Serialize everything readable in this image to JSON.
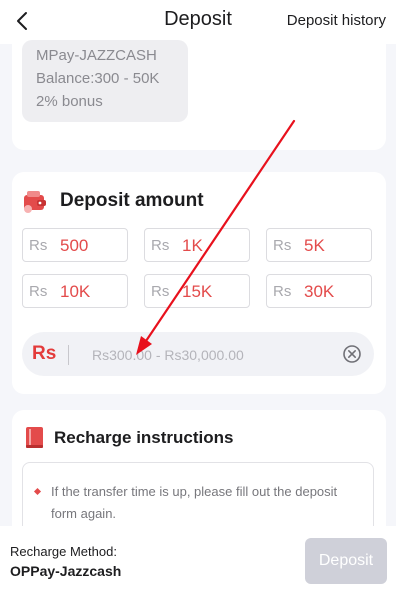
{
  "header": {
    "title": "Deposit",
    "history_label": "Deposit history",
    "back_icon": "chevron-left-icon"
  },
  "method_card": {
    "lines": [
      "MPay-JAZZCASH",
      "Balance:300 - 50K",
      "2% bonus"
    ]
  },
  "amount_card": {
    "title": "Deposit amount",
    "icon": "wallet-icon",
    "options": [
      {
        "currency": "Rs",
        "value": "500"
      },
      {
        "currency": "Rs",
        "value": "1K"
      },
      {
        "currency": "Rs",
        "value": "5K"
      },
      {
        "currency": "Rs",
        "value": "10K"
      },
      {
        "currency": "Rs",
        "value": "15K"
      },
      {
        "currency": "Rs",
        "value": "30K"
      }
    ],
    "input": {
      "currency": "Rs",
      "value": "",
      "placeholder": "Rs300.00 - Rs30,000.00"
    }
  },
  "instructions": {
    "title": "Recharge instructions",
    "icon": "book-icon",
    "items": [
      "If the transfer time is up, please fill out the deposit form again."
    ]
  },
  "bottom": {
    "method_label": "Recharge Method:",
    "method_value": "OPPay-Jazzcash",
    "deposit_label": "Deposit"
  },
  "colors": {
    "accent_red": "#e34b4b",
    "button_disabled": "#cfd0d9",
    "annotation_arrow": "#e8111d"
  }
}
